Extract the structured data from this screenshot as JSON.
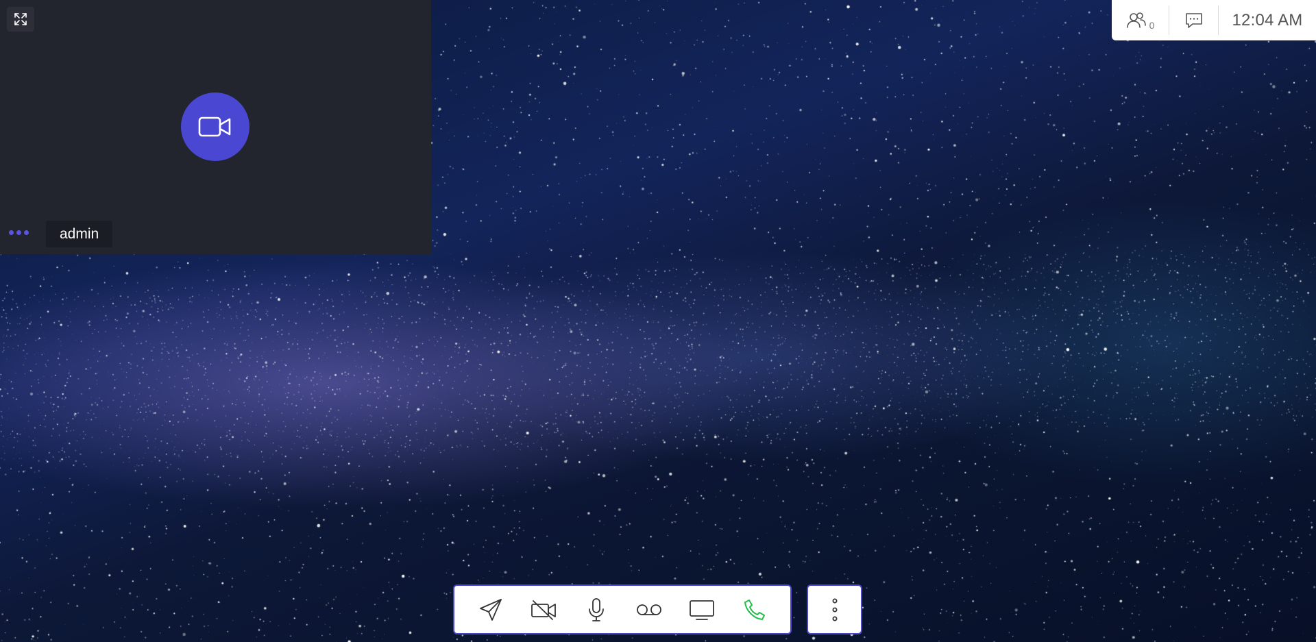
{
  "self_view": {
    "display_name": "admin",
    "expand_icon": "expand-arrows-icon",
    "camera_icon": "video-camera-icon",
    "avatar_color": "#4a48d3",
    "speaking_indicator_color": "#5a55e0"
  },
  "info_bar": {
    "participants_icon": "participants-icon",
    "participant_count": "0",
    "chat_icon": "chat-bubble-icon",
    "time": "12:04 AM"
  },
  "toolbar": {
    "accent_color": "#4b45c9",
    "buttons": [
      {
        "name": "send",
        "icon": "send-arrow-icon"
      },
      {
        "name": "camera-off",
        "icon": "video-off-icon"
      },
      {
        "name": "microphone",
        "icon": "microphone-icon"
      },
      {
        "name": "voicemail",
        "icon": "voicemail-icon"
      },
      {
        "name": "screen-share",
        "icon": "monitor-icon"
      },
      {
        "name": "call",
        "icon": "phone-icon",
        "color": "#1fbf4a"
      }
    ],
    "more_icon": "more-vertical-icon"
  },
  "background": "starry-night-sky"
}
